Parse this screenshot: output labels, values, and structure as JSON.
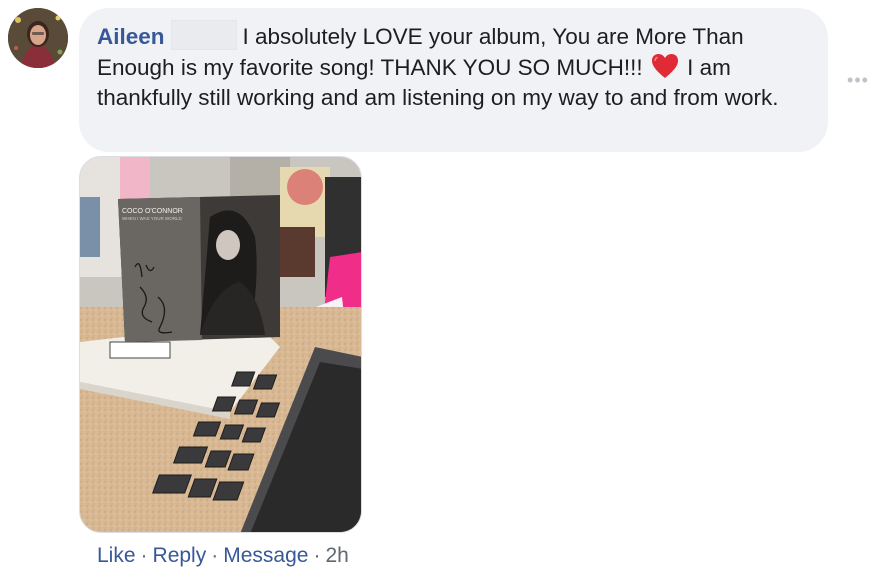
{
  "comment": {
    "author": "Aileen",
    "text_part1": "I absolutely LOVE your album, You are More Than Enough is my favorite song! THANK YOU SO MUCH!!!",
    "text_part2": "I am thankfully still working and am listening on my way to and from work.",
    "more_icon": "more-dots-icon",
    "heart_icon": "red-heart-emoji"
  },
  "photo": {
    "album_artist": "COCO O'CONNOR",
    "album_title": "WHEN I WAS YOUR WORLD",
    "autograph": "To Aileen, Love, Coco O'Connor"
  },
  "actions": {
    "like": "Like",
    "reply": "Reply",
    "message": "Message",
    "separator": "·",
    "timestamp": "2h"
  },
  "colors": {
    "link": "#385898",
    "bubble_bg": "#f0f2f5",
    "meta_text": "#606770",
    "heart": "#e02a35"
  }
}
